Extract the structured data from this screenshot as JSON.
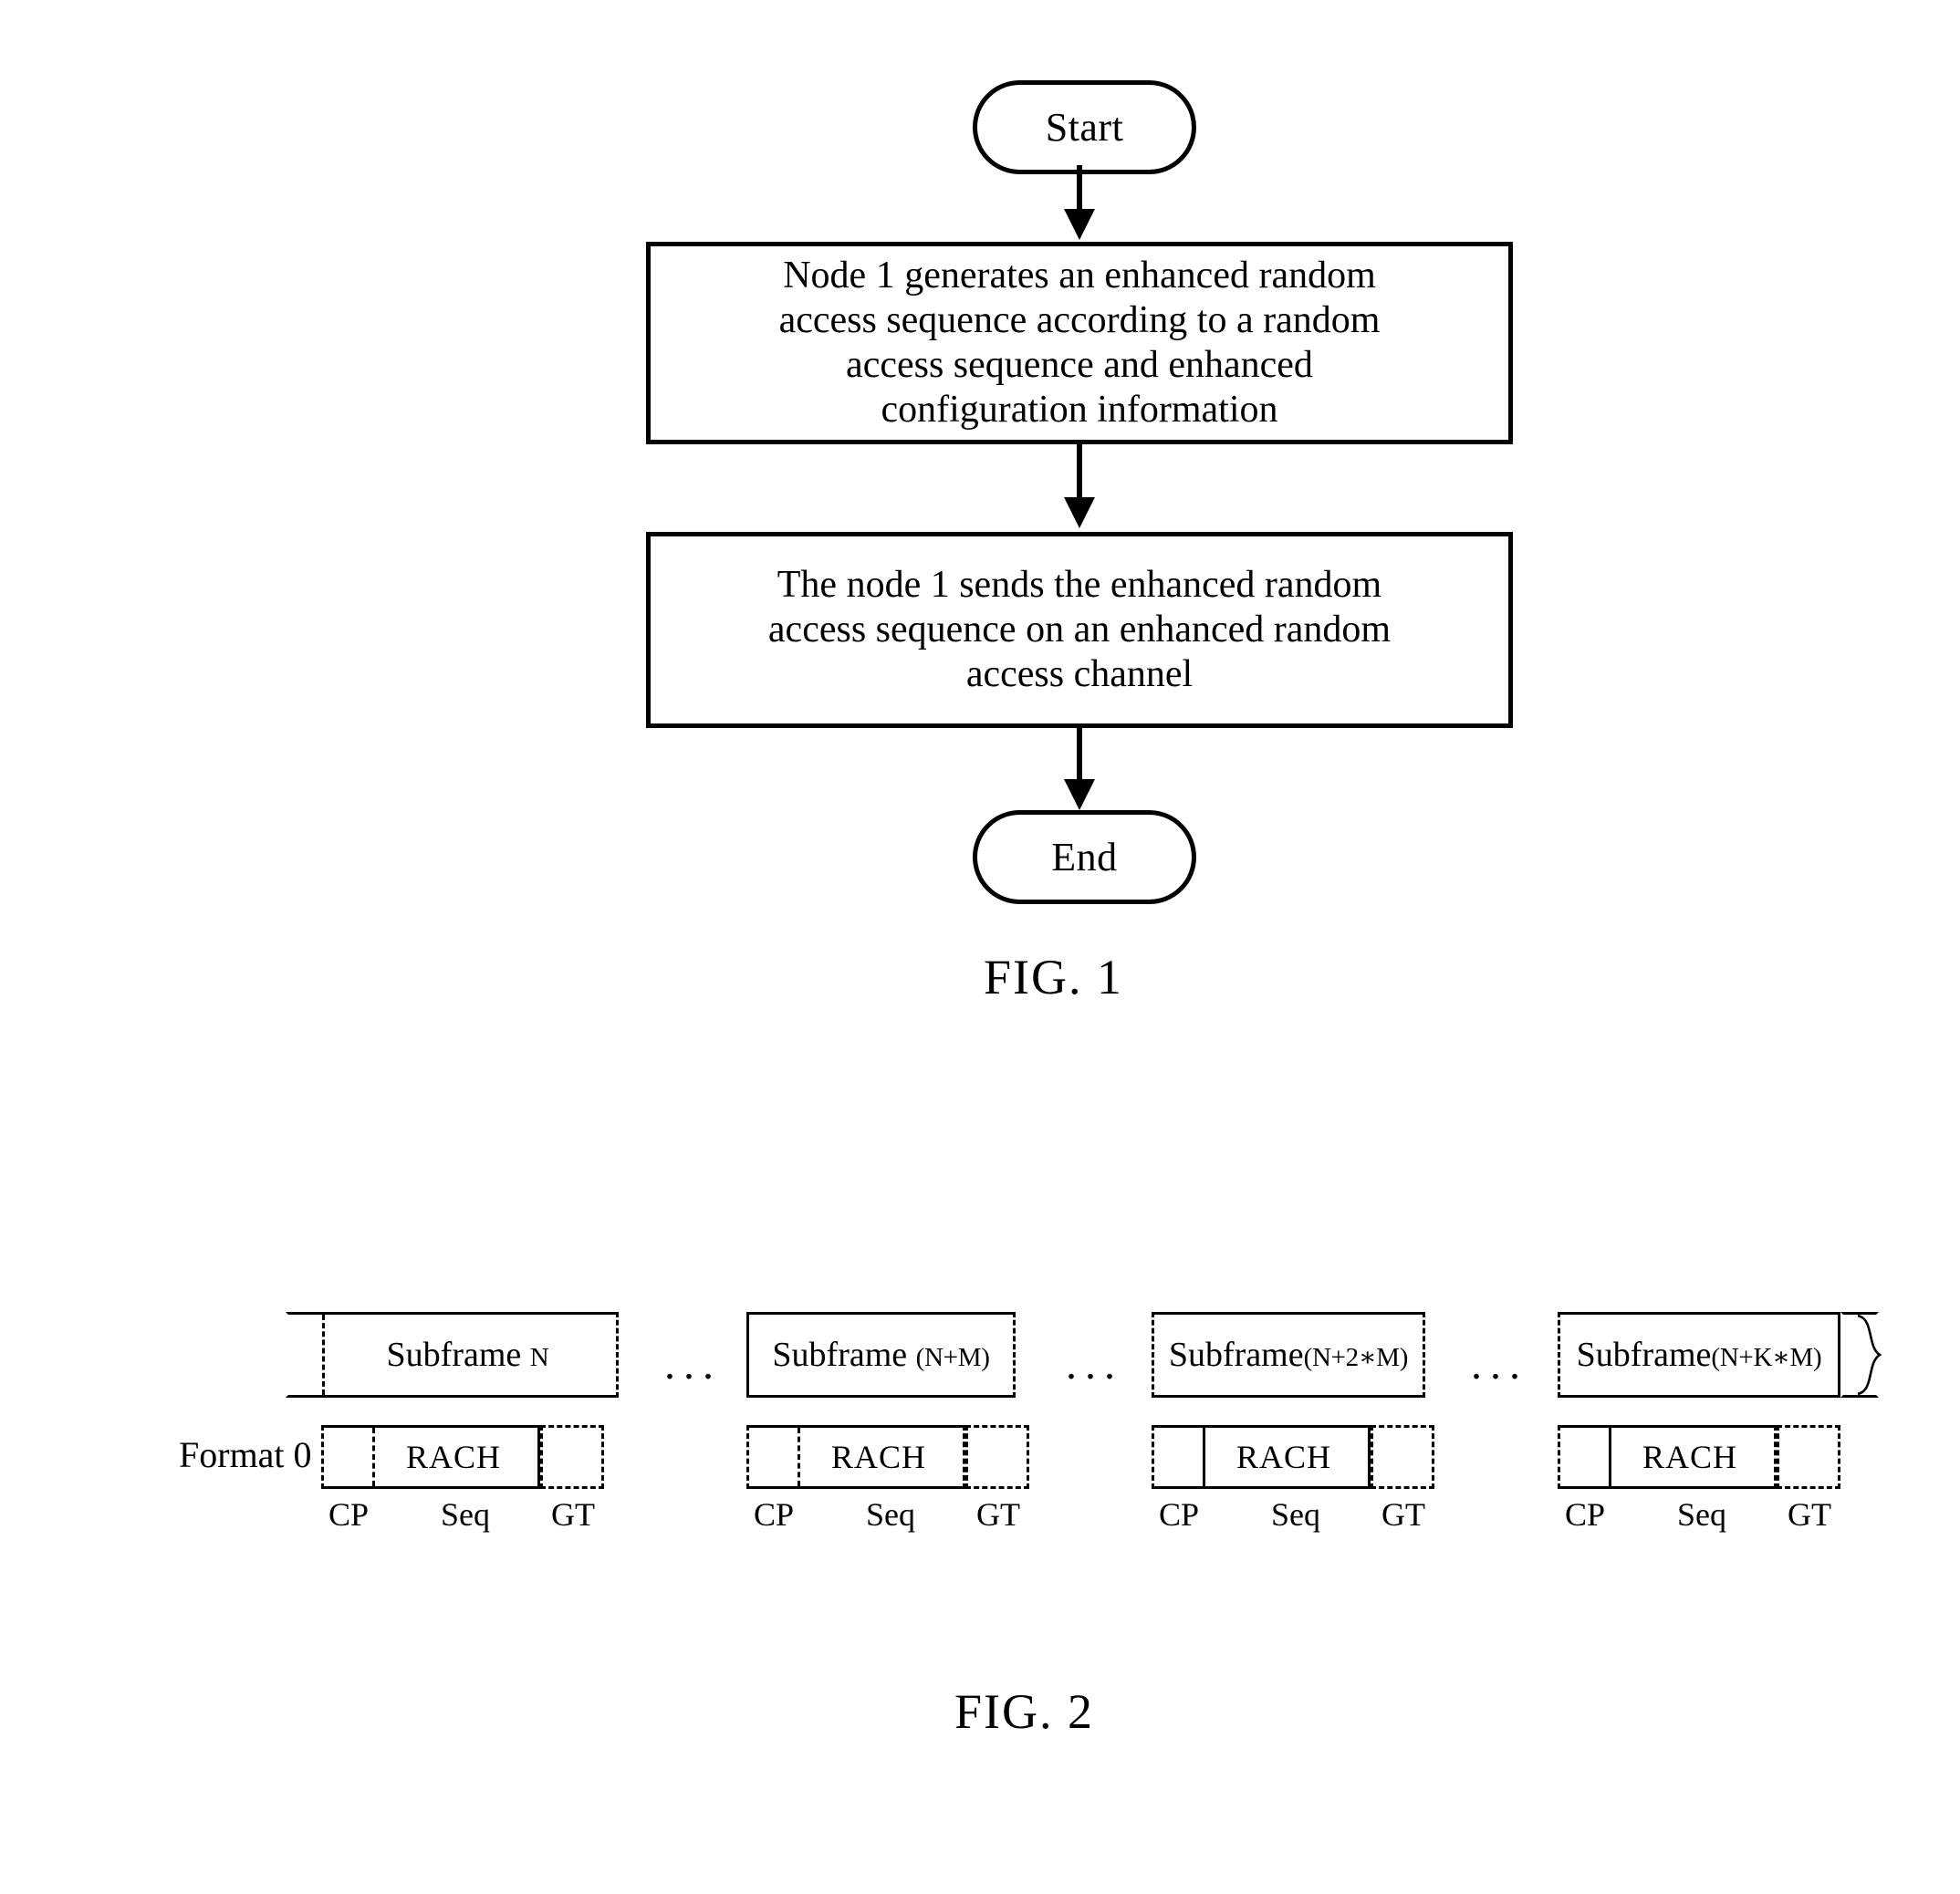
{
  "document": {
    "type": "patent-figure-sheet",
    "background_color": "#ffffff",
    "ink_color": "#000000"
  },
  "fig1": {
    "caption": "FIG. 1",
    "start_label": "Start",
    "end_label": "End",
    "step1": {
      "lines": [
        "Node 1 generates an enhanced random",
        "access sequence according to a random",
        "access sequence and enhanced",
        "configuration information"
      ]
    },
    "step2": {
      "lines": [
        "The node 1 sends the enhanced random",
        "access sequence on an enhanced random",
        "access channel"
      ]
    }
  },
  "fig2": {
    "caption": "FIG. 2",
    "format_label": "Format 0",
    "ellipsis": "...",
    "rach_label": "RACH",
    "tick_labels": {
      "cp": "CP",
      "seq": "Seq",
      "gt": "GT"
    },
    "groups": [
      {
        "subframe_prefix": "Subframe ",
        "subframe_index": "N",
        "rach": "RACH",
        "cp": "CP",
        "seq": "Seq",
        "gt": "GT"
      },
      {
        "subframe_prefix": "Subframe ",
        "subframe_index": "(N+M)",
        "rach": "RACH",
        "cp": "CP",
        "seq": "Seq",
        "gt": "GT"
      },
      {
        "subframe_prefix": "Subframe",
        "subframe_index": "(N+2∗M)",
        "rach": "RACH",
        "cp": "CP",
        "seq": "Seq",
        "gt": "GT"
      },
      {
        "subframe_prefix": "Subframe",
        "subframe_index": "(N+K∗M)",
        "rach": "RACH",
        "cp": "CP",
        "seq": "Seq",
        "gt": "GT"
      }
    ]
  }
}
